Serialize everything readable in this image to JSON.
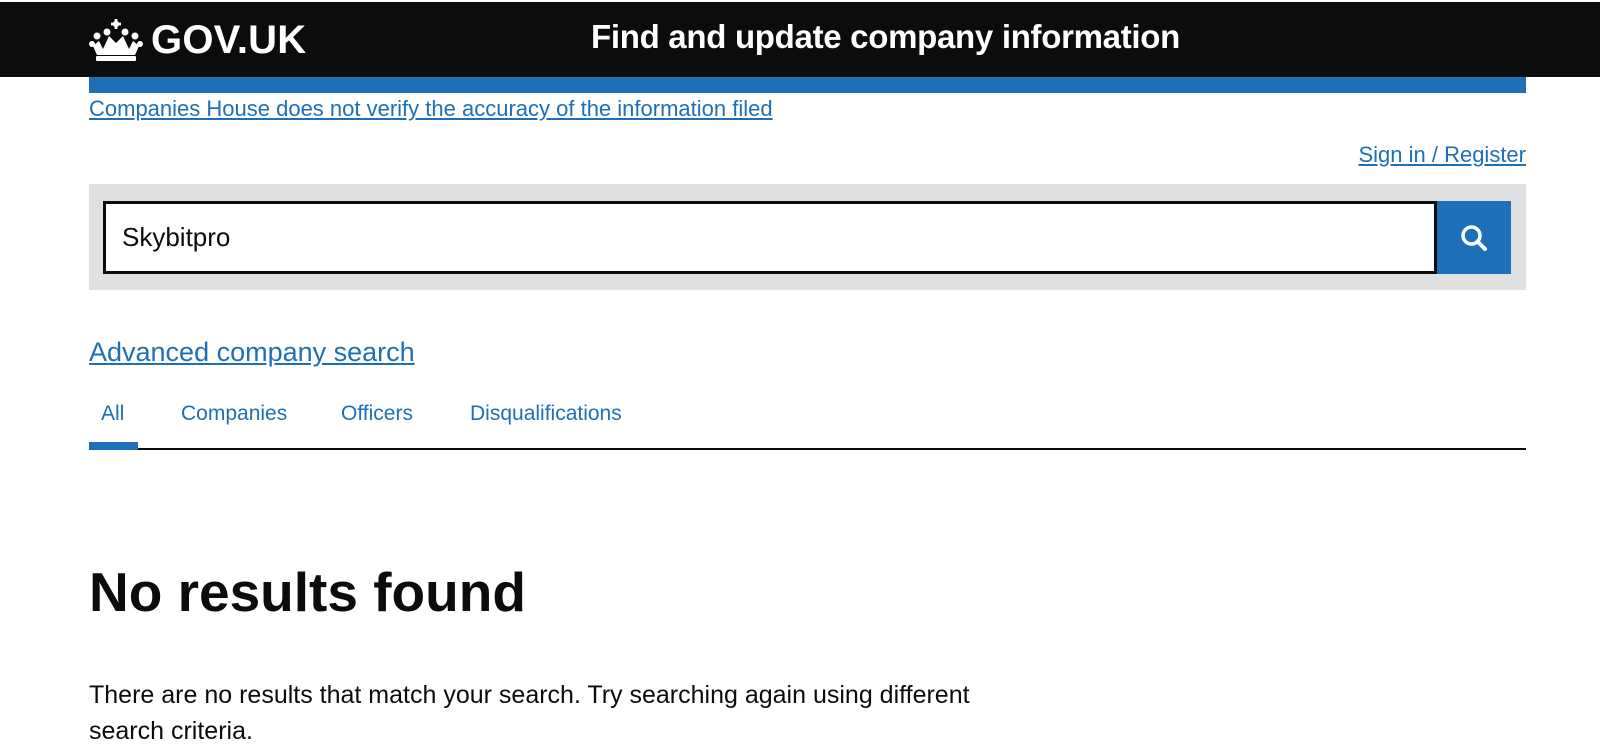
{
  "header": {
    "logo_text": "GOV.UK",
    "service_name": "Find and update company information"
  },
  "phase_banner": {
    "link": "Companies House does not verify the accuracy of the information filed"
  },
  "account": {
    "sign_in": "Sign in / Register"
  },
  "search": {
    "value": "Skybitpro",
    "button_icon": "search-icon"
  },
  "advanced_search": "Advanced company search",
  "tabs": [
    {
      "label": "All",
      "active": true
    },
    {
      "label": "Companies",
      "active": false
    },
    {
      "label": "Officers",
      "active": false
    },
    {
      "label": "Disqualifications",
      "active": false
    }
  ],
  "results": {
    "heading": "No results found",
    "message": "There are no results that match your search. Try searching again using different search criteria."
  },
  "colors": {
    "header_bg": "#0b0c0c",
    "link_blue": "#1d70b8",
    "search_panel_bg": "#dee0e2"
  }
}
